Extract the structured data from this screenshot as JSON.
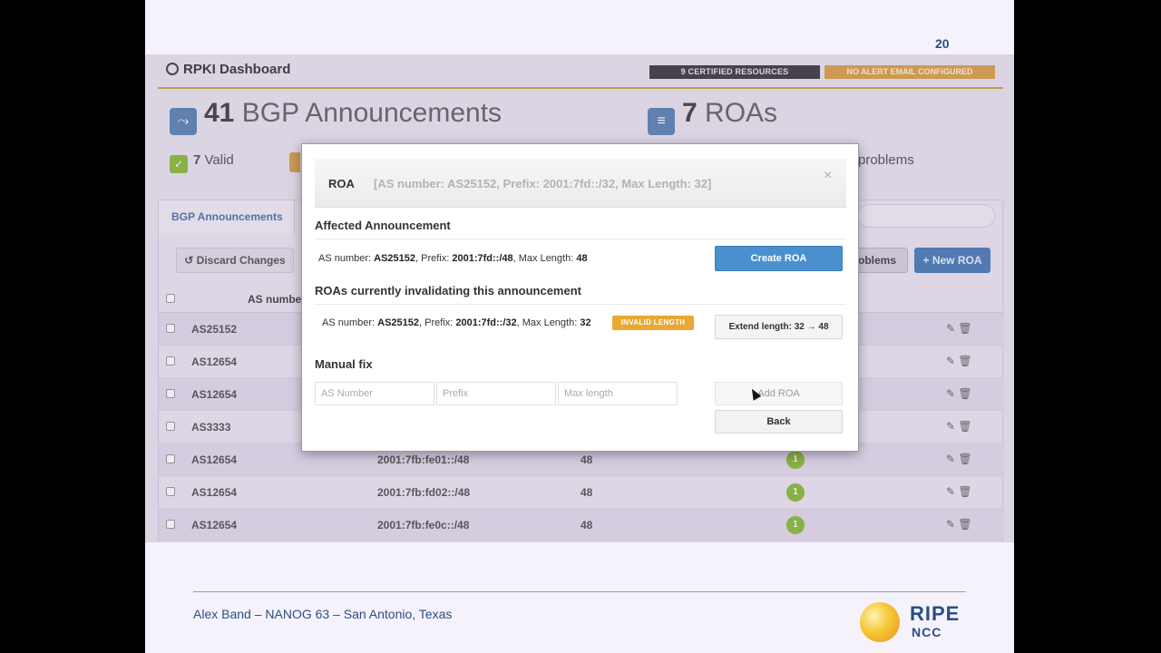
{
  "slide": {
    "page_number": "20"
  },
  "dashboard": {
    "title": "RPKI Dashboard",
    "badges": {
      "certified": "9 CERTIFIED RESOURCES",
      "alert": "NO ALERT EMAIL CONFIGURED"
    },
    "stats": {
      "bgp_count": "41",
      "bgp_label": "BGP Announcements",
      "roa_count": "7",
      "roa_label": "ROAs"
    },
    "mini": {
      "valid_count": "7",
      "valid_label": "Valid",
      "problems_label": "problems"
    },
    "tab_label": "BGP Announcements",
    "buttons": {
      "discard": "Discard Changes",
      "problems": "oblems",
      "new_roa": "New ROA"
    },
    "table": {
      "col_as": "AS numbe",
      "rows": [
        {
          "as": "AS25152",
          "prefix": "",
          "max": "",
          "count": ""
        },
        {
          "as": "AS12654",
          "prefix": "",
          "max": "",
          "count": ""
        },
        {
          "as": "AS12654",
          "prefix": "",
          "max": "",
          "count": ""
        },
        {
          "as": "AS3333",
          "prefix": "",
          "max": "",
          "count": ""
        },
        {
          "as": "AS12654",
          "prefix": "2001:7fb:fe01::/48",
          "max": "48",
          "count": "1"
        },
        {
          "as": "AS12654",
          "prefix": "2001:7fb:fd02::/48",
          "max": "48",
          "count": "1"
        },
        {
          "as": "AS12654",
          "prefix": "2001:7fb:fe0c::/48",
          "max": "48",
          "count": "1"
        }
      ]
    }
  },
  "modal": {
    "title": "ROA",
    "subtitle": "[AS number: AS25152, Prefix: 2001:7fd::/32, Max Length: 32]",
    "close": "×",
    "affected_title": "Affected Announcement",
    "affected": {
      "as_label": "AS number: ",
      "as_value": "AS25152",
      "prefix_label": ", Prefix: ",
      "prefix_value": "2001:7fd::/48",
      "max_label": ", Max Length: ",
      "max_value": "48"
    },
    "create_button": "Create ROA",
    "invalidating_title": "ROAs currently invalidating this announcement",
    "invalidating": {
      "as_label": "AS number: ",
      "as_value": "AS25152",
      "prefix_label": ", Prefix: ",
      "prefix_value": "2001:7fd::/32",
      "max_label": ", Max Length: ",
      "max_value": "32",
      "tag": "INVALID LENGTH"
    },
    "extend_button": "Extend length: 32 → 48",
    "manual_title": "Manual fix",
    "inputs": {
      "as_placeholder": "AS Number",
      "prefix_placeholder": "Prefix",
      "maxlen_placeholder": "Max length"
    },
    "add_button": "Add ROA",
    "back_button": "Back"
  },
  "footer": {
    "text": "Alex Band – NANOG 63 – San Antonio, Texas",
    "logo_top": "RIPE",
    "logo_bottom": "NCC"
  },
  "colors": {
    "accent_blue": "#4a90cf",
    "valid_green": "#8bbd3c",
    "warning_orange": "#e9a831",
    "brand_blue": "#2b4e86"
  }
}
